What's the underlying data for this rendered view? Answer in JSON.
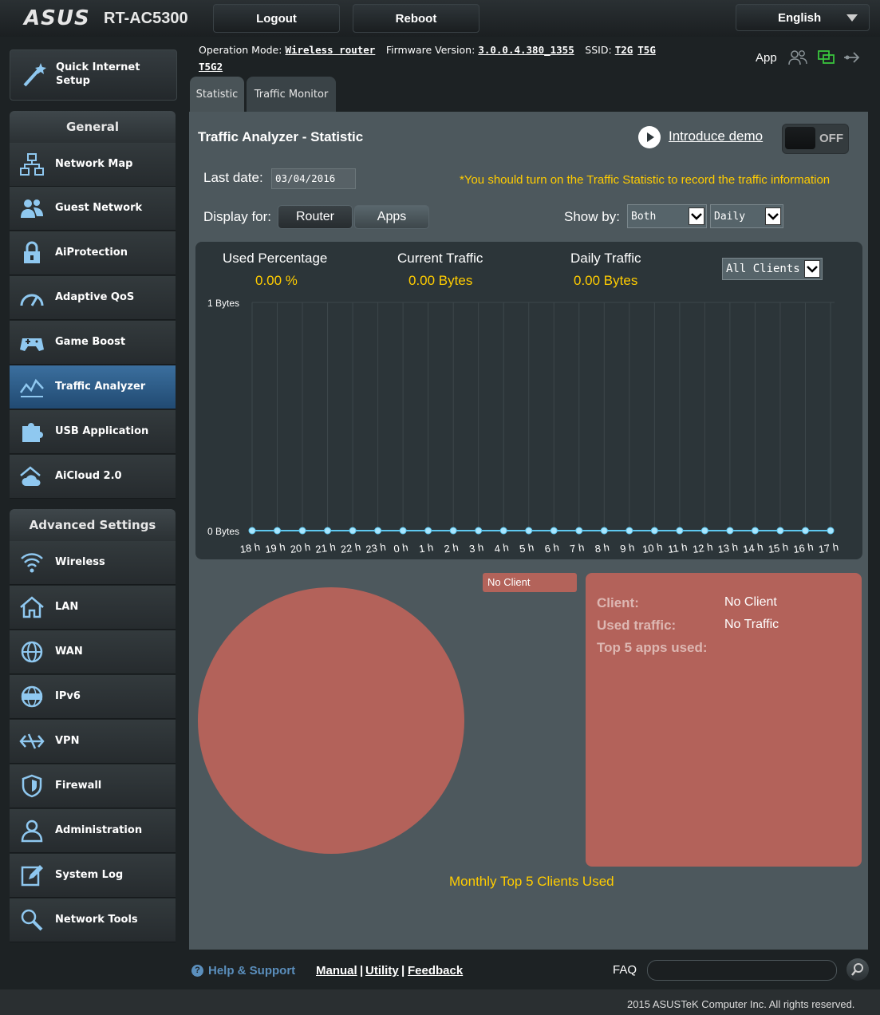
{
  "header": {
    "brand": "ASUS",
    "model": "RT-AC5300",
    "logout_label": "Logout",
    "reboot_label": "Reboot",
    "language": "English"
  },
  "status": {
    "op_mode_label": "Operation Mode:",
    "op_mode_value": "Wireless router",
    "firmware_label": "Firmware Version:",
    "firmware_value": "3.0.0.4.380_1355",
    "ssid_label": "SSID:",
    "ssid_1": "T2G",
    "ssid_2": "T5G",
    "ssid_3": "T5G2",
    "app_label": "App"
  },
  "tabs": [
    "Statistic",
    "Traffic Monitor"
  ],
  "sidebar": {
    "quick_setup": "Quick Internet Setup",
    "general_header": "General",
    "general": [
      "Network Map",
      "Guest Network",
      "AiProtection",
      "Adaptive QoS",
      "Game Boost",
      "Traffic Analyzer",
      "USB Application",
      "AiCloud 2.0"
    ],
    "advanced_header": "Advanced Settings",
    "advanced": [
      "Wireless",
      "LAN",
      "WAN",
      "IPv6",
      "VPN",
      "Firewall",
      "Administration",
      "System Log",
      "Network Tools"
    ],
    "active": "Traffic Analyzer"
  },
  "main": {
    "title": "Traffic Analyzer - Statistic",
    "introduce_demo": "Introduce demo",
    "toggle": "OFF",
    "last_date_label": "Last date:",
    "last_date": "03/04/2016",
    "notice": "*You should turn on the Traffic Statistic to record the traffic information",
    "display_for_label": "Display for:",
    "router_label": "Router",
    "apps_label": "Apps",
    "show_by_label": "Show by:",
    "show_by_1": "Both",
    "show_by_2": "Daily",
    "used_percentage_label": "Used Percentage",
    "used_percentage": "0.00 %",
    "current_traffic_label": "Current Traffic",
    "current_traffic": "0.00 Bytes",
    "daily_traffic_label": "Daily Traffic",
    "daily_traffic": "0.00 Bytes",
    "clients_select": "All Clients"
  },
  "chart_data": {
    "type": "line",
    "x": [
      "18 h",
      "19 h",
      "20 h",
      "21 h",
      "22 h",
      "23 h",
      "0 h",
      "1 h",
      "2 h",
      "3 h",
      "4 h",
      "5 h",
      "6 h",
      "7 h",
      "8 h",
      "9 h",
      "10 h",
      "11 h",
      "12 h",
      "13 h",
      "14 h",
      "15 h",
      "16 h",
      "17 h"
    ],
    "series": [
      {
        "values": [
          0,
          0,
          0,
          0,
          0,
          0,
          0,
          0,
          0,
          0,
          0,
          0,
          0,
          0,
          0,
          0,
          0,
          0,
          0,
          0,
          0,
          0,
          0,
          0
        ]
      }
    ],
    "ylim": [
      0,
      1
    ],
    "ytick_labels": [
      "0 Bytes",
      "1 Bytes"
    ],
    "grid": true,
    "colors": {
      "line": "#5ec8f0",
      "grid": "#3d474b"
    }
  },
  "pie": {
    "legend_label": "No Client",
    "client_label": "Client:",
    "client_value": "No Client",
    "used_traffic_label": "Used traffic:",
    "used_traffic_value": "No Traffic",
    "top_apps_label": "Top 5 apps used:",
    "title": "Monthly Top 5 Clients Used",
    "color": "#b3625a"
  },
  "footer": {
    "help": "Help & Support",
    "manual": "Manual",
    "utility": "Utility",
    "feedback": "Feedback",
    "faq": "FAQ",
    "copyright": "2015 ASUSTeK Computer Inc. All rights reserved."
  }
}
